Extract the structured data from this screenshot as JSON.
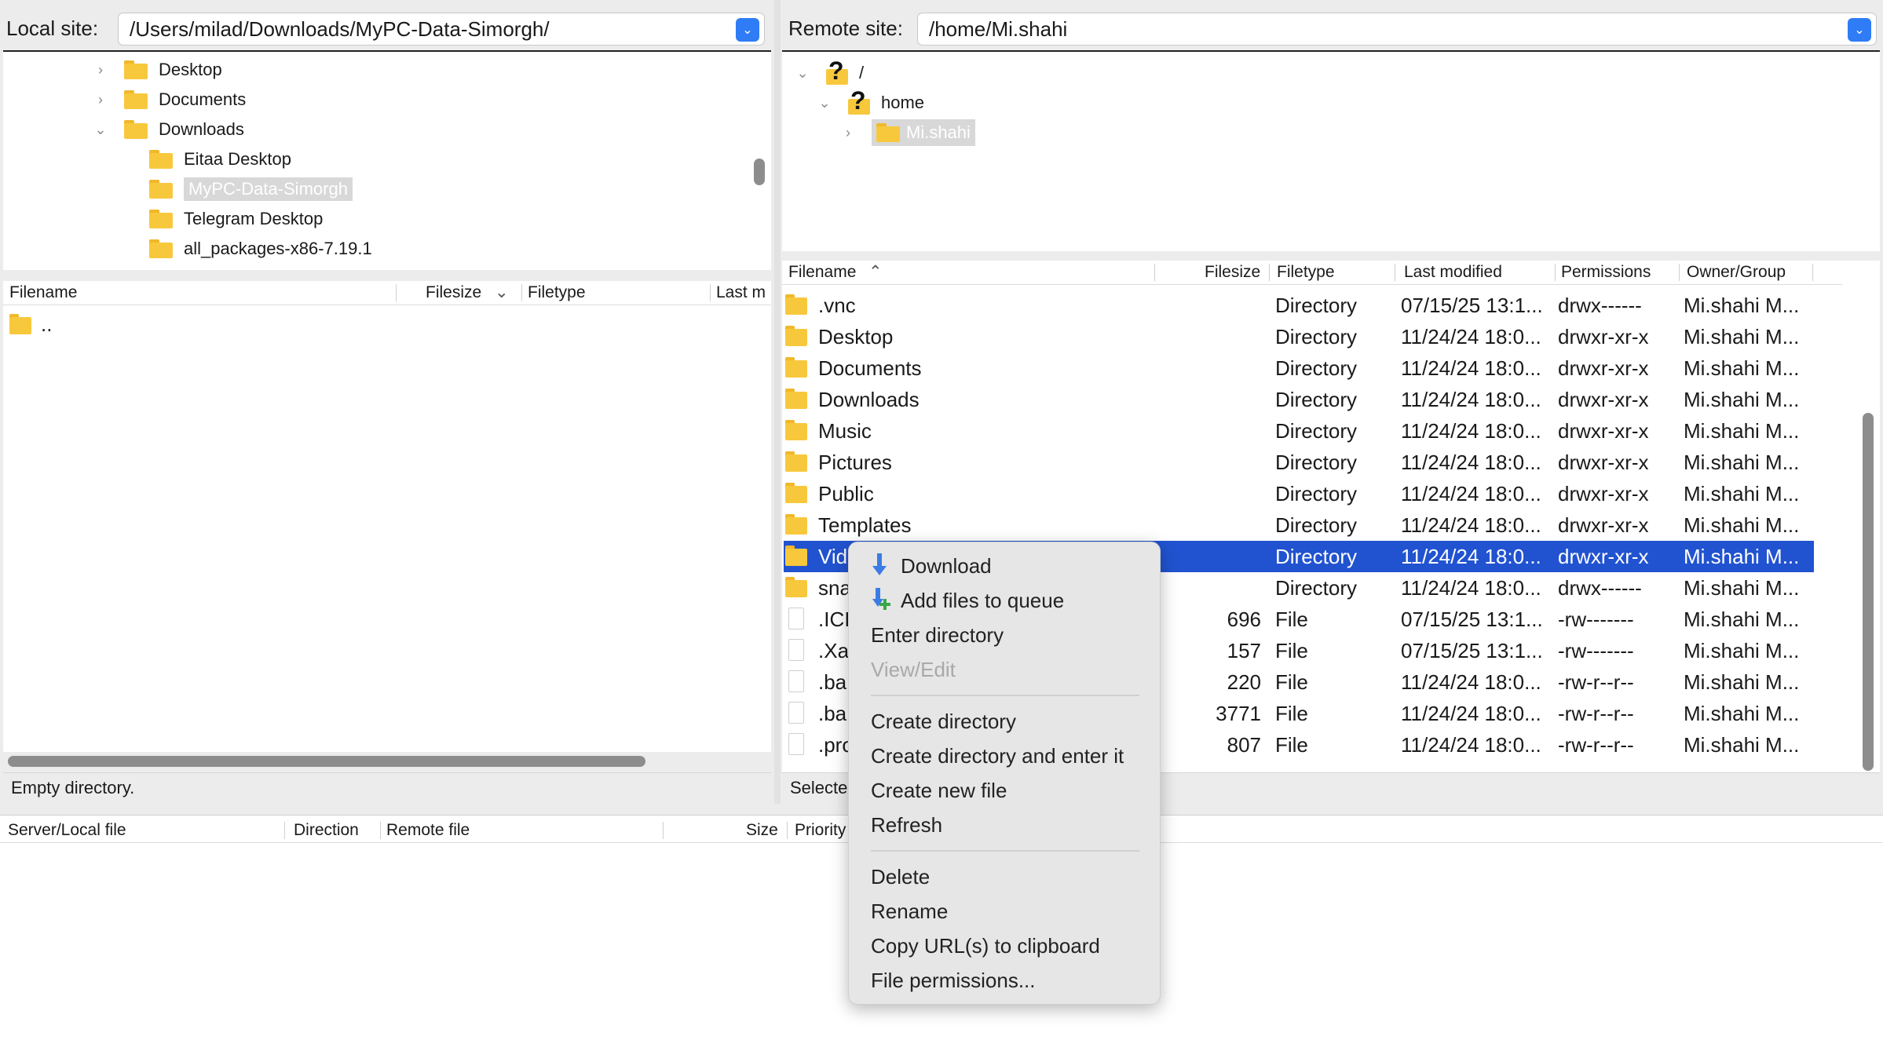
{
  "local": {
    "label": "Local site:",
    "path": "/Users/milad/Downloads/MyPC-Data-Simorgh/",
    "tree": [
      {
        "label": "Desktop",
        "chevron": "›"
      },
      {
        "label": "Documents",
        "chevron": "›"
      },
      {
        "label": "Downloads",
        "chevron": "⌄"
      },
      {
        "label": "Eitaa Desktop"
      },
      {
        "label": "MyPC-Data-Simorgh"
      },
      {
        "label": "Telegram Desktop"
      },
      {
        "label": "all_packages-x86-7.19.1"
      }
    ],
    "columns": {
      "filename": "Filename",
      "filesize": "Filesize",
      "filetype": "Filetype",
      "lastmod": "Last m"
    },
    "rows": [
      {
        "name": ".."
      }
    ],
    "status": "Empty directory."
  },
  "remote": {
    "label": "Remote site:",
    "path": "/home/Mi.shahi",
    "tree": [
      {
        "label": "/",
        "chevron": "⌄"
      },
      {
        "label": "home",
        "chevron": "⌄"
      },
      {
        "label": "Mi.shahi",
        "chevron": "›"
      }
    ],
    "columns": {
      "filename": "Filename",
      "filesize": "Filesize",
      "filetype": "Filetype",
      "lastmod": "Last modified",
      "perms": "Permissions",
      "owner": "Owner/Group"
    },
    "rows": [
      {
        "name": ".vnc",
        "size": "",
        "type": "Directory",
        "mod": "07/15/25 13:1...",
        "perm": "drwx------",
        "owner": "Mi.shahi M...",
        "kind": "dir"
      },
      {
        "name": "Desktop",
        "size": "",
        "type": "Directory",
        "mod": "11/24/24 18:0...",
        "perm": "drwxr-xr-x",
        "owner": "Mi.shahi M...",
        "kind": "dir"
      },
      {
        "name": "Documents",
        "size": "",
        "type": "Directory",
        "mod": "11/24/24 18:0...",
        "perm": "drwxr-xr-x",
        "owner": "Mi.shahi M...",
        "kind": "dir"
      },
      {
        "name": "Downloads",
        "size": "",
        "type": "Directory",
        "mod": "11/24/24 18:0...",
        "perm": "drwxr-xr-x",
        "owner": "Mi.shahi M...",
        "kind": "dir"
      },
      {
        "name": "Music",
        "size": "",
        "type": "Directory",
        "mod": "11/24/24 18:0...",
        "perm": "drwxr-xr-x",
        "owner": "Mi.shahi M...",
        "kind": "dir"
      },
      {
        "name": "Pictures",
        "size": "",
        "type": "Directory",
        "mod": "11/24/24 18:0...",
        "perm": "drwxr-xr-x",
        "owner": "Mi.shahi M...",
        "kind": "dir"
      },
      {
        "name": "Public",
        "size": "",
        "type": "Directory",
        "mod": "11/24/24 18:0...",
        "perm": "drwxr-xr-x",
        "owner": "Mi.shahi M...",
        "kind": "dir"
      },
      {
        "name": "Templates",
        "size": "",
        "type": "Directory",
        "mod": "11/24/24 18:0...",
        "perm": "drwxr-xr-x",
        "owner": "Mi.shahi M...",
        "kind": "dir"
      },
      {
        "name": "Vid",
        "size": "",
        "type": "Directory",
        "mod": "11/24/24 18:0...",
        "perm": "drwxr-xr-x",
        "owner": "Mi.shahi M...",
        "kind": "dir",
        "selected": true
      },
      {
        "name": "sna",
        "size": "",
        "type": "Directory",
        "mod": "11/24/24 18:0...",
        "perm": "drwx------",
        "owner": "Mi.shahi M...",
        "kind": "dir"
      },
      {
        "name": ".ICI",
        "size": "696",
        "type": "File",
        "mod": "07/15/25 13:1...",
        "perm": "-rw-------",
        "owner": "Mi.shahi M...",
        "kind": "file"
      },
      {
        "name": ".Xa",
        "size": "157",
        "type": "File",
        "mod": "07/15/25 13:1...",
        "perm": "-rw-------",
        "owner": "Mi.shahi M...",
        "kind": "file"
      },
      {
        "name": ".ba",
        "size": "220",
        "type": "File",
        "mod": "11/24/24 18:0...",
        "perm": "-rw-r--r--",
        "owner": "Mi.shahi M...",
        "kind": "file"
      },
      {
        "name": ".ba",
        "size": "3771",
        "type": "File",
        "mod": "11/24/24 18:0...",
        "perm": "-rw-r--r--",
        "owner": "Mi.shahi M...",
        "kind": "file"
      },
      {
        "name": ".pro",
        "size": "807",
        "type": "File",
        "mod": "11/24/24 18:0...",
        "perm": "-rw-r--r--",
        "owner": "Mi.shahi M...",
        "kind": "file"
      }
    ],
    "status": "Selecte"
  },
  "queue": {
    "columns": {
      "server": "Server/Local file",
      "direction": "Direction",
      "remote": "Remote file",
      "size": "Size",
      "priority": "Priority"
    }
  },
  "context_menu": {
    "download": "Download",
    "add_queue": "Add files to queue",
    "enter_dir": "Enter directory",
    "view_edit": "View/Edit",
    "create_dir": "Create directory",
    "create_dir_enter": "Create directory and enter it",
    "create_file": "Create new file",
    "refresh": "Refresh",
    "delete": "Delete",
    "rename": "Rename",
    "copy_url": "Copy URL(s) to clipboard",
    "file_perms": "File permissions..."
  },
  "colors": {
    "selection": "#2153d0",
    "accent": "#2f7cf6",
    "folder": "#f8c83c"
  }
}
